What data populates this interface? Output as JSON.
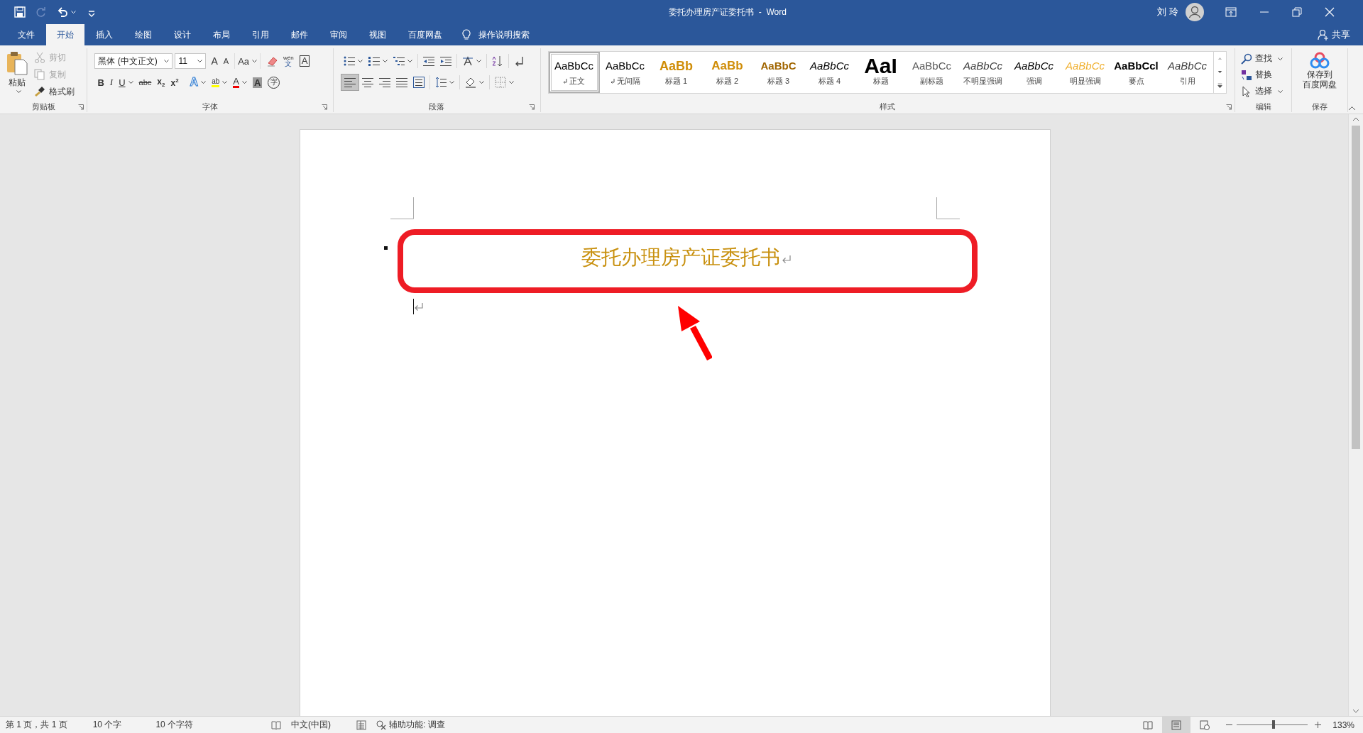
{
  "window": {
    "title": "委托办理房产证委托书  -  Word",
    "user": "刘 玲"
  },
  "quick_access": [
    {
      "kind": "save",
      "disabled": false
    },
    {
      "kind": "redo",
      "disabled": true
    },
    {
      "kind": "undo",
      "disabled": false
    },
    {
      "kind": "customize",
      "disabled": false
    }
  ],
  "tabs": [
    {
      "label": "文件",
      "selected": false
    },
    {
      "label": "开始",
      "selected": true
    },
    {
      "label": "插入",
      "selected": false
    },
    {
      "label": "绘图",
      "selected": false
    },
    {
      "label": "设计",
      "selected": false
    },
    {
      "label": "布局",
      "selected": false
    },
    {
      "label": "引用",
      "selected": false
    },
    {
      "label": "邮件",
      "selected": false
    },
    {
      "label": "审阅",
      "selected": false
    },
    {
      "label": "视图",
      "selected": false
    },
    {
      "label": "百度网盘",
      "selected": false
    }
  ],
  "tell_me": "操作说明搜索",
  "share": "共享",
  "ribbon": {
    "clipboard": {
      "label": "剪贴板",
      "paste": "粘贴",
      "items": [
        {
          "kind": "cut",
          "label": "剪切",
          "disabled": true
        },
        {
          "kind": "copy",
          "label": "复制",
          "disabled": true
        },
        {
          "kind": "format_painter",
          "label": "格式刷",
          "disabled": false
        }
      ]
    },
    "font": {
      "label": "字体",
      "font_name": "黑体 (中文正文)",
      "font_size": "11",
      "row1": [
        {
          "kind": "grow",
          "glyph": "A",
          "menu": false
        },
        {
          "kind": "shrink",
          "glyph": "A",
          "menu": false
        },
        {
          "kind": "case",
          "glyph": "Aa",
          "menu": true
        },
        {
          "kind": "clear",
          "menu": false
        },
        {
          "kind": "phonetic",
          "top": "wén",
          "glyph": "文",
          "menu": false
        },
        {
          "kind": "border",
          "glyph": "A",
          "menu": false
        }
      ],
      "row2": [
        {
          "kind": "bold",
          "glyph": "B",
          "menu": false
        },
        {
          "kind": "italic",
          "glyph": "I",
          "menu": false
        },
        {
          "kind": "underline",
          "glyph": "U",
          "menu": true
        },
        {
          "kind": "strike",
          "glyph": "abc",
          "menu": false
        },
        {
          "kind": "subscript",
          "glyph": "x$_{2}$",
          "menu": false
        },
        {
          "kind": "superscript",
          "glyph": "x$^{2}$",
          "menu": false
        },
        {
          "kind": "effects",
          "glyph": "A",
          "menu": true
        },
        {
          "kind": "highlight",
          "glyph": "ab",
          "menu": true
        },
        {
          "kind": "color",
          "glyph": "A",
          "menu": true
        },
        {
          "kind": "shading",
          "glyph": "A",
          "menu": false
        },
        {
          "kind": "enclose",
          "glyph": "字",
          "menu": false
        }
      ]
    },
    "paragraph": {
      "label": "段落",
      "row1": [
        {
          "kind": "bullets",
          "menu": true
        },
        {
          "kind": "numbering",
          "menu": true
        },
        {
          "kind": "multilevel",
          "menu": true
        },
        {
          "kind": "outdent",
          "menu": false
        },
        {
          "kind": "indent",
          "menu": false
        },
        {
          "kind": "asian",
          "menu": true
        },
        {
          "kind": "sort",
          "menu": false
        },
        {
          "kind": "marks",
          "menu": false
        }
      ],
      "alignment": [
        {
          "kind": "left",
          "selected": true
        },
        {
          "kind": "center",
          "selected": false
        },
        {
          "kind": "right",
          "selected": false
        },
        {
          "kind": "justify",
          "selected": false
        },
        {
          "kind": "distributed",
          "selected": false
        }
      ],
      "row2": [
        {
          "kind": "spacing",
          "menu": true
        },
        {
          "kind": "fill",
          "menu": true
        },
        {
          "kind": "borders",
          "menu": true
        }
      ]
    },
    "styles": {
      "label": "样式",
      "items": [
        {
          "kind": "normal",
          "sample": "AaBbCc",
          "name": "正文",
          "selected": true,
          "mark": true
        },
        {
          "kind": "normal",
          "sample": "AaBbCc",
          "name": "无间隔",
          "selected": false,
          "mark": true
        },
        {
          "kind": "h1",
          "sample": "AaBb",
          "name": "标题 1",
          "selected": false,
          "mark": false
        },
        {
          "kind": "h2",
          "sample": "AaBb",
          "name": "标题 2",
          "selected": false,
          "mark": false
        },
        {
          "kind": "h3",
          "sample": "AaBbC",
          "name": "标题 3",
          "selected": false,
          "mark": false
        },
        {
          "kind": "h4",
          "sample": "AaBbCc",
          "name": "标题 4",
          "selected": false,
          "mark": false
        },
        {
          "kind": "title",
          "sample": "AaI",
          "name": "标题",
          "selected": false,
          "mark": false
        },
        {
          "kind": "subtitle",
          "sample": "AaBbCc",
          "name": "副标题",
          "selected": false,
          "mark": false
        },
        {
          "kind": "subtle",
          "sample": "AaBbCc",
          "name": "不明显强调",
          "selected": false,
          "mark": false
        },
        {
          "kind": "emphasis",
          "sample": "AaBbCc",
          "name": "强调",
          "selected": false,
          "mark": false
        },
        {
          "kind": "intense",
          "sample": "AaBbCc",
          "name": "明显强调",
          "selected": false,
          "mark": false
        },
        {
          "kind": "strong",
          "sample": "AaBbCcl",
          "name": "要点",
          "selected": false,
          "mark": false
        },
        {
          "kind": "quote",
          "sample": "AaBbCc",
          "name": "引用",
          "selected": false,
          "mark": false
        }
      ]
    },
    "editing": {
      "label": "编辑",
      "items": [
        {
          "kind": "find",
          "label": "查找",
          "menu": true
        },
        {
          "kind": "replace",
          "label": "替换",
          "menu": false
        },
        {
          "kind": "select",
          "label": "选择",
          "menu": true
        }
      ]
    },
    "save": {
      "label": "保存",
      "button": [
        "保存到",
        "百度网盘"
      ]
    }
  },
  "document": {
    "heading": "委托办理房产证委托书",
    "highlight_frame": true,
    "pointer_arrow": true
  },
  "status_bar": {
    "left": [
      "第 1 页，共 1 页",
      "10 个字",
      "10 个字符"
    ],
    "language": "中文(中国)",
    "accessibility": "辅助功能: 调查",
    "views": [
      {
        "kind": "read",
        "selected": false
      },
      {
        "kind": "print",
        "selected": true
      },
      {
        "kind": "web",
        "selected": false
      }
    ],
    "zoom": {
      "level": 0.52,
      "reading": "133%"
    }
  }
}
